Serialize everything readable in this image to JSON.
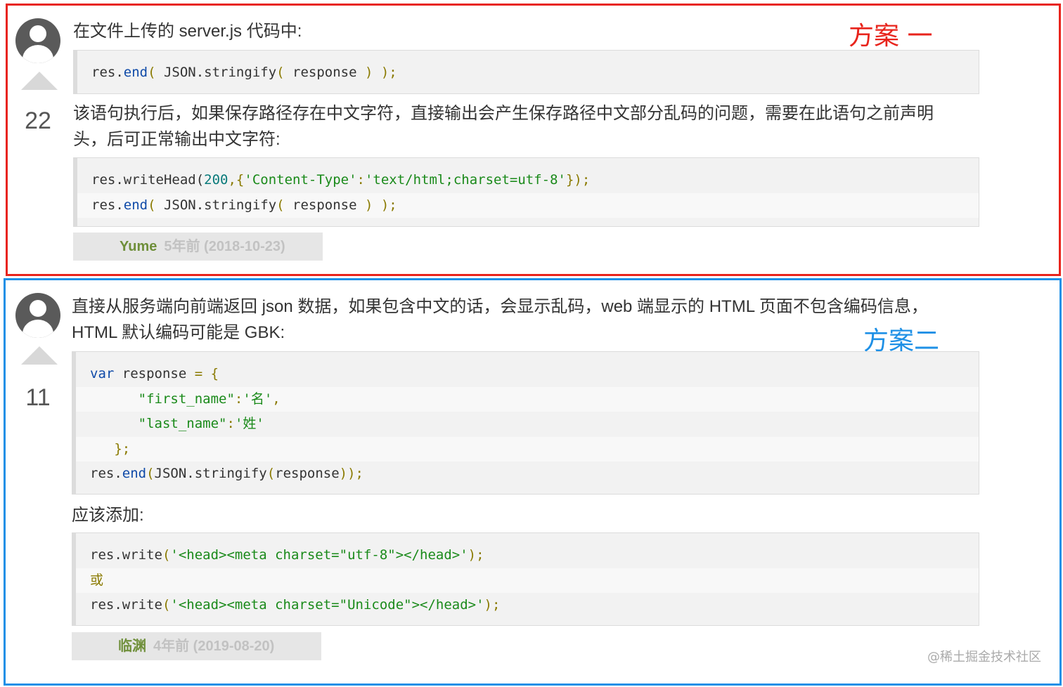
{
  "answers": [
    {
      "score": "22",
      "tag": "方案 一",
      "tag_color": "#e8241c",
      "border_color": "#e8241c",
      "intro": "在文件上传的 server.js 代码中:",
      "code1": [
        "res.end( JSON.stringify( response ) );"
      ],
      "explanation_line1": "该语句执行后，如果保存路径存在中文字符，直接输出会产生保存路径中文部分乱码的问题，需要在此语句之前声明",
      "explanation_line2": "头，后可正常输出中文字符:",
      "code2": [
        "res.writeHead(200,{'Content-Type':'text/html;charset=utf-8'});",
        "res.end( JSON.stringify( response ) );"
      ],
      "user": "Yume",
      "time": "5年前 (2018-10-23)"
    },
    {
      "score": "11",
      "tag": "方案二",
      "tag_color": "#1e90e6",
      "border_color": "#1e90e6",
      "intro_line1": "直接从服务端向前端返回 json 数据，如果包含中文的话，会显示乱码，web 端显示的 HTML 页面不包含编码信息，",
      "intro_line2": "HTML 默认编码可能是 GBK:",
      "code1": [
        "var response = {",
        "      \"first_name\":'名',",
        "      \"last_name\":'姓'",
        "   };",
        "res.end(JSON.stringify(response));"
      ],
      "middle_text": "应该添加:",
      "code2": [
        "res.write('<head><meta charset=\"utf-8\"></head>');",
        "或",
        "res.write('<head><meta charset=\"Unicode\"></head>');"
      ],
      "user": "临渊",
      "time": "4年前 (2019-08-20)"
    }
  ],
  "watermark": "@稀土掘金技术社区"
}
